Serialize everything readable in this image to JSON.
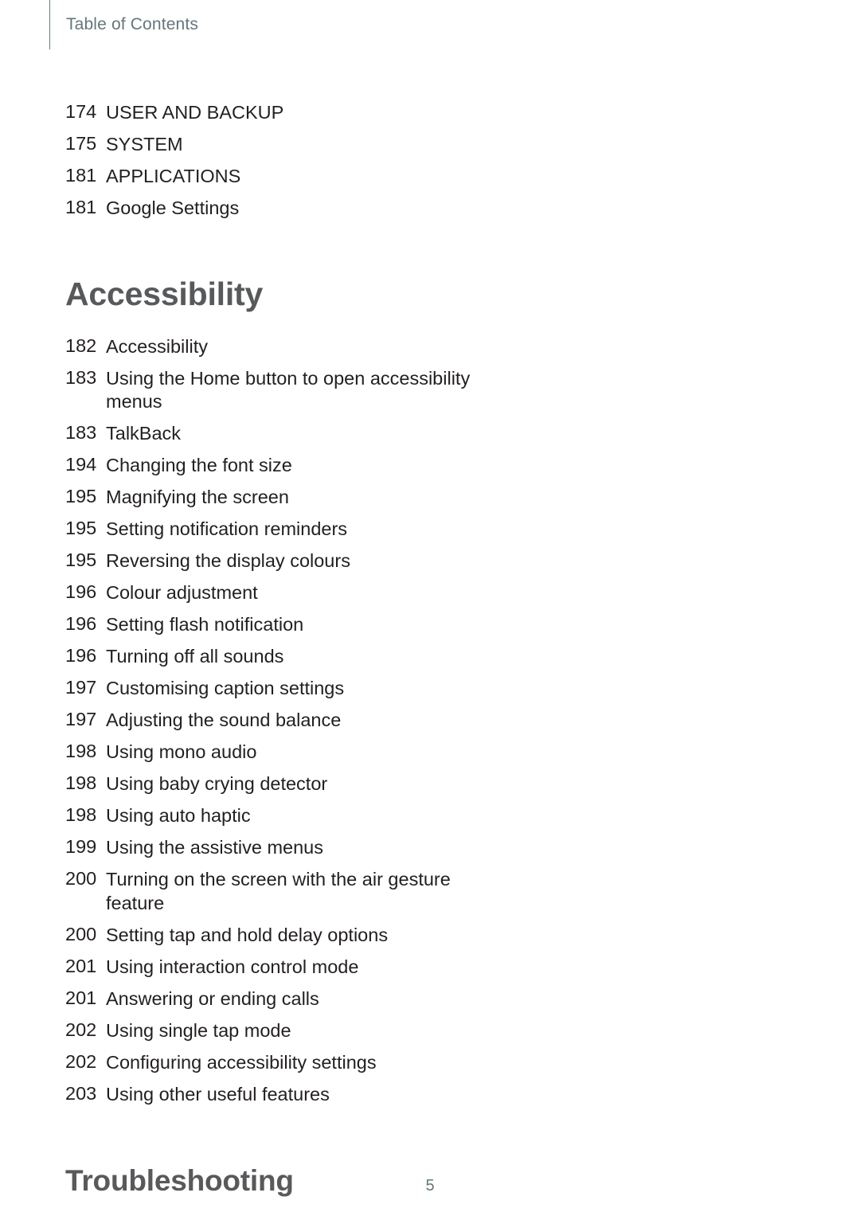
{
  "header": {
    "title": "Table of Contents"
  },
  "groups": [
    {
      "id": "settings-continued",
      "heading": null,
      "entries": [
        {
          "page": "174",
          "title": "USER AND BACKUP"
        },
        {
          "page": "175",
          "title": "SYSTEM"
        },
        {
          "page": "181",
          "title": "APPLICATIONS"
        },
        {
          "page": "181",
          "title": "Google Settings"
        }
      ]
    },
    {
      "id": "accessibility",
      "heading": "Accessibility",
      "entries": [
        {
          "page": "182",
          "title": "Accessibility"
        },
        {
          "page": "183",
          "title": "Using the Home button to open accessibility menus"
        },
        {
          "page": "183",
          "title": "TalkBack"
        },
        {
          "page": "194",
          "title": "Changing the font size"
        },
        {
          "page": "195",
          "title": "Magnifying the screen"
        },
        {
          "page": "195",
          "title": "Setting notification reminders"
        },
        {
          "page": "195",
          "title": "Reversing the display colours"
        },
        {
          "page": "196",
          "title": "Colour adjustment"
        },
        {
          "page": "196",
          "title": "Setting flash notification"
        },
        {
          "page": "196",
          "title": "Turning off all sounds"
        },
        {
          "page": "197",
          "title": "Customising caption settings"
        },
        {
          "page": "197",
          "title": "Adjusting the sound balance"
        },
        {
          "page": "198",
          "title": "Using mono audio"
        },
        {
          "page": "198",
          "title": "Using baby crying detector"
        },
        {
          "page": "198",
          "title": "Using auto haptic"
        },
        {
          "page": "199",
          "title": "Using the assistive menus"
        },
        {
          "page": "200",
          "title": "Turning on the screen with the air gesture feature"
        },
        {
          "page": "200",
          "title": "Setting tap and hold delay options"
        },
        {
          "page": "201",
          "title": "Using interaction control mode"
        },
        {
          "page": "201",
          "title": "Answering or ending calls"
        },
        {
          "page": "202",
          "title": "Using single tap mode"
        },
        {
          "page": "202",
          "title": "Configuring accessibility settings"
        },
        {
          "page": "203",
          "title": "Using other useful features"
        }
      ]
    },
    {
      "id": "troubleshooting",
      "heading": "Troubleshooting",
      "entries": []
    }
  ],
  "footer": {
    "page_number": "5"
  },
  "colors": {
    "body_text": "#231f20",
    "heading_text": "#58595b",
    "header_text": "#64767a",
    "rule": "#6b7b7f",
    "background": "#ffffff"
  }
}
